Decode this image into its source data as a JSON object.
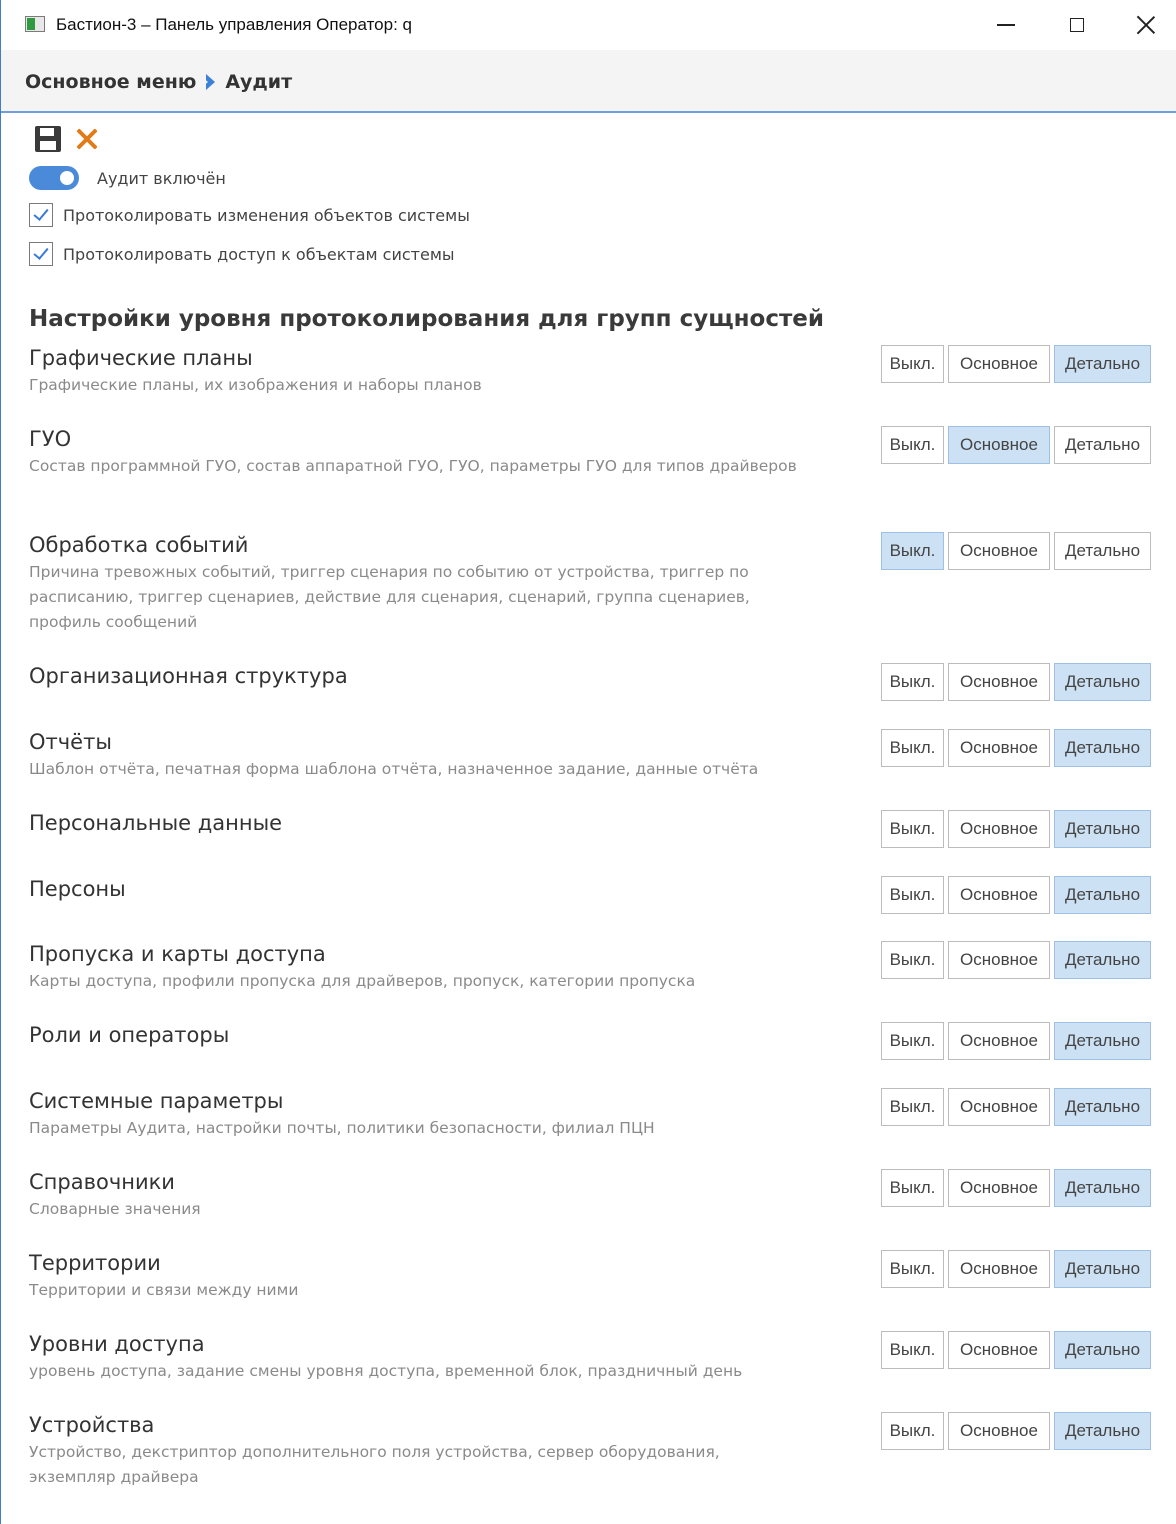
{
  "window": {
    "title": "Бастион-3 – Панель управления Оператор: q"
  },
  "breadcrumb": {
    "root": "Основное меню",
    "current": "Аудит"
  },
  "toolbar": {
    "save_icon": "save-icon",
    "cancel_icon": "close-icon"
  },
  "audit": {
    "enabled_label": "Аудит включён",
    "enabled": true,
    "log_changes_label": "Протоколировать изменения объектов системы",
    "log_changes": true,
    "log_access_label": "Протоколировать доступ к объектам системы",
    "log_access": true
  },
  "section": {
    "title": "Настройки уровня протоколирования для групп сущностей"
  },
  "level_labels": {
    "off": "Выкл.",
    "basic": "Основное",
    "detail": "Детально"
  },
  "groups": [
    {
      "name": "Графические планы",
      "desc": "Графические планы, их изображения и наборы планов",
      "level": "detail"
    },
    {
      "name": "ГУО",
      "desc": "Состав программной ГУО, состав аппаратной ГУО, ГУО, параметры ГУО для типов драйверов",
      "level": "basic"
    },
    {
      "name": "Обработка событий",
      "desc": "Причина тревожных событий, триггер сценария по событию от устройства, триггер по расписанию, триггер сценариев, действие для сценария, сценарий, группа сценариев, профиль сообщений",
      "level": "off"
    },
    {
      "name": "Организационная структура",
      "desc": "",
      "level": "detail"
    },
    {
      "name": "Отчёты",
      "desc": "Шаблон отчёта, печатная форма шаблона отчёта, назначенное задание, данные отчёта",
      "level": "detail"
    },
    {
      "name": "Персональные данные",
      "desc": "",
      "level": "detail"
    },
    {
      "name": "Персоны",
      "desc": "",
      "level": "detail"
    },
    {
      "name": "Пропуска и карты доступа",
      "desc": "Карты доступа, профили пропуска для драйверов, пропуск, категории пропуска",
      "level": "detail"
    },
    {
      "name": "Роли и операторы",
      "desc": "",
      "level": "detail"
    },
    {
      "name": "Системные параметры",
      "desc": "Параметры Аудита, настройки почты, политики безопасности, филиал ПЦН",
      "level": "detail"
    },
    {
      "name": "Справочники",
      "desc": "Словарные значения",
      "level": "detail"
    },
    {
      "name": "Территории",
      "desc": "Территории и связи между ними",
      "level": "detail"
    },
    {
      "name": "Уровни доступа",
      "desc": "уровень доступа, задание смены уровня доступа, временной блок, праздничный день",
      "level": "detail"
    },
    {
      "name": "Устройства",
      "desc": "Устройство, декстриптор дополнительного поля устройства, сервер оборудования, экземпляр драйвера",
      "level": "detail"
    }
  ]
}
